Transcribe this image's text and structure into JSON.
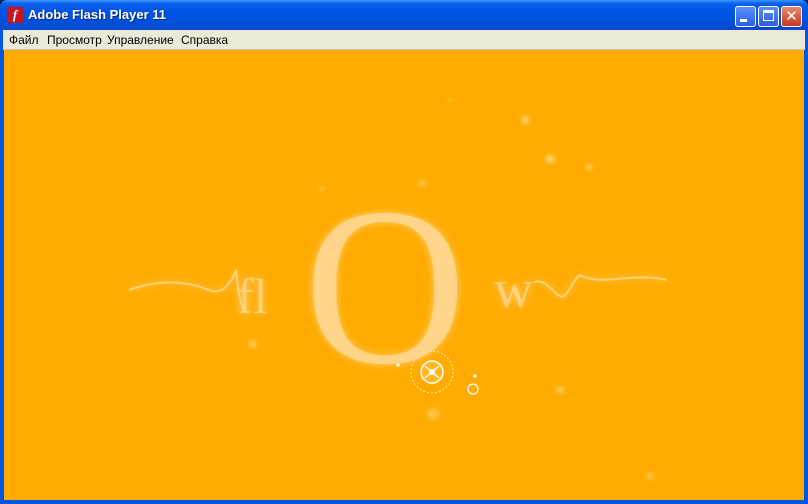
{
  "window": {
    "title": "Adobe Flash Player 11",
    "app_icon_glyph": "f",
    "close_glyph": "✕"
  },
  "menu": {
    "items": [
      {
        "label": "Файл"
      },
      {
        "label": "Просмотр"
      },
      {
        "label": "Управление"
      },
      {
        "label": "Справка"
      }
    ]
  },
  "content": {
    "background_color": "#ffab00",
    "logo": {
      "left_text": "fl",
      "center_text": "O",
      "right_text": "w"
    }
  }
}
